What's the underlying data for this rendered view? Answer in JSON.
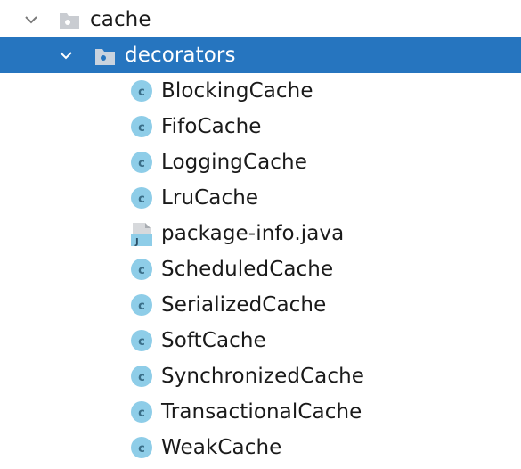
{
  "tree": {
    "root": {
      "label": "cache",
      "icon": "package-folder-icon",
      "expanded": true
    },
    "child": {
      "label": "decorators",
      "icon": "package-folder-icon",
      "expanded": true,
      "selected": true
    },
    "items": [
      {
        "label": "BlockingCache",
        "icon": "class-icon"
      },
      {
        "label": "FifoCache",
        "icon": "class-icon"
      },
      {
        "label": "LoggingCache",
        "icon": "class-icon"
      },
      {
        "label": "LruCache",
        "icon": "class-icon"
      },
      {
        "label": "package-info.java",
        "icon": "java-file-icon"
      },
      {
        "label": "ScheduledCache",
        "icon": "class-icon"
      },
      {
        "label": "SerializedCache",
        "icon": "class-icon"
      },
      {
        "label": "SoftCache",
        "icon": "class-icon"
      },
      {
        "label": "SynchronizedCache",
        "icon": "class-icon"
      },
      {
        "label": "TransactionalCache",
        "icon": "class-icon"
      },
      {
        "label": "WeakCache",
        "icon": "class-icon"
      }
    ]
  },
  "colors": {
    "selection": "#2675bf",
    "class_icon_fill": "#8ecde8",
    "class_icon_letter": "#3a6e88",
    "folder_fill": "#c9ccd1"
  }
}
